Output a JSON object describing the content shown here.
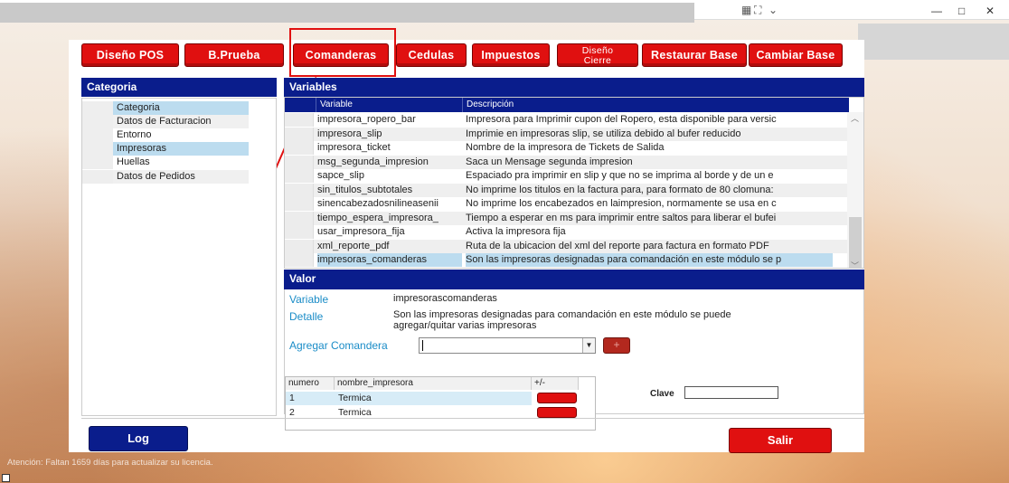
{
  "window": {
    "controls": [
      "—",
      "□",
      "✕"
    ]
  },
  "toolbar": {
    "tabs": [
      "Diseño POS",
      "B.Prueba",
      "Comanderas",
      "Cedulas",
      "Impuestos",
      [
        "Diseño",
        "Cierre"
      ],
      "Restaurar Base",
      "Cambiar Base"
    ]
  },
  "categoria": {
    "title": "Categoria",
    "items": [
      "Categoria",
      "Datos de Facturacion",
      "Entorno",
      "Impresoras",
      "Huellas",
      "Datos de Pedidos"
    ],
    "selected": "Impresoras"
  },
  "variables": {
    "title": "Variables",
    "columns": [
      "Variable",
      "Descripción"
    ],
    "rows": [
      [
        "impresora_ropero_bar",
        "Impresora para Imprimir cupon del Ropero, esta disponible para versic"
      ],
      [
        "impresora_slip",
        "Imprimie en impresoras slip, se utiliza debido al bufer reducido"
      ],
      [
        "impresora_ticket",
        "Nombre de la impresora de Tickets de Salida"
      ],
      [
        "msg_segunda_impresion",
        "Saca un Mensage segunda impresion"
      ],
      [
        "sapce_slip",
        "Espaciado pra imprimir en slip y que no se imprima al borde y de un e"
      ],
      [
        "sin_titulos_subtotales",
        "No imprime los titulos en la factura para, para formato de 80 clomuna:"
      ],
      [
        "sinencabezadosnilineasenii",
        "No imprime los encabezados en laimpresion, normamente se usa en c"
      ],
      [
        "tiempo_espera_impresora_",
        "Tiempo a esperar en ms para imprimir entre saltos para liberar el bufei"
      ],
      [
        "usar_impresora_fija",
        "Activa la impresora fija"
      ],
      [
        "xml_reporte_pdf",
        "Ruta de la ubicacion del xml del reporte para factura en formato PDF"
      ],
      [
        "impresoras_comanderas",
        "Son las impresoras designadas para comandación en este módulo se p"
      ]
    ],
    "selected_index": 10
  },
  "valor": {
    "title": "Valor",
    "variable_label": "Variable",
    "variable_value": "impresorascomanderas",
    "detalle_label": "Detalle",
    "detalle_line1": "Son las impresoras designadas para comandación en este módulo se puede",
    "detalle_line2": "agregar/quitar varias impresoras",
    "agregar_label": "Agregar Comandera",
    "agregar_value": "",
    "add_symbol": "+",
    "clave_label": "Clave",
    "clave_value": "",
    "columns": [
      "numero",
      "nombre_impresora",
      "+/-"
    ],
    "rows": [
      [
        "1",
        "Termica"
      ],
      [
        "2",
        "Termica"
      ]
    ]
  },
  "footer": {
    "log_label": "Log",
    "salir_label": "Salir",
    "status_text": "Atención: Faltan 1659 días para actualizar su licencia."
  },
  "colors": {
    "header_blue": "#0a1d8c",
    "button_red": "#e01010",
    "label_blue": "#1a8cc7",
    "selection": "#bcdcef"
  }
}
